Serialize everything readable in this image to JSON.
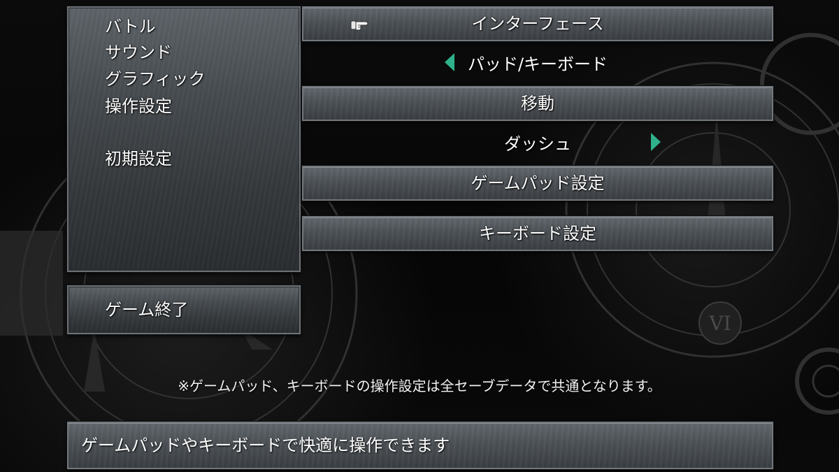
{
  "sidebar": {
    "items": [
      {
        "label": "バトル"
      },
      {
        "label": "サウンド"
      },
      {
        "label": "グラフィック"
      },
      {
        "label": "操作設定"
      },
      {
        "label": "初期設定"
      }
    ],
    "exit_label": "ゲーム終了"
  },
  "settings": {
    "interface_header": "インターフェース",
    "interface_value": "パッド/キーボード",
    "movement_header": "移動",
    "movement_value": "ダッシュ",
    "gamepad_button": "ゲームパッド設定",
    "keyboard_button": "キーボード設定"
  },
  "note": "※ゲームパッド、キーボードの操作設定は全セーブデータで共通となります。",
  "help_text": "ゲームパッドやキーボードで快適に操作できます",
  "icons": {
    "cursor": "pointing-hand-icon",
    "left": "left-arrow-icon",
    "right": "right-arrow-icon"
  },
  "colors": {
    "accent": "#2fb28c",
    "panel": "#4c5156",
    "text": "#ffffff"
  }
}
